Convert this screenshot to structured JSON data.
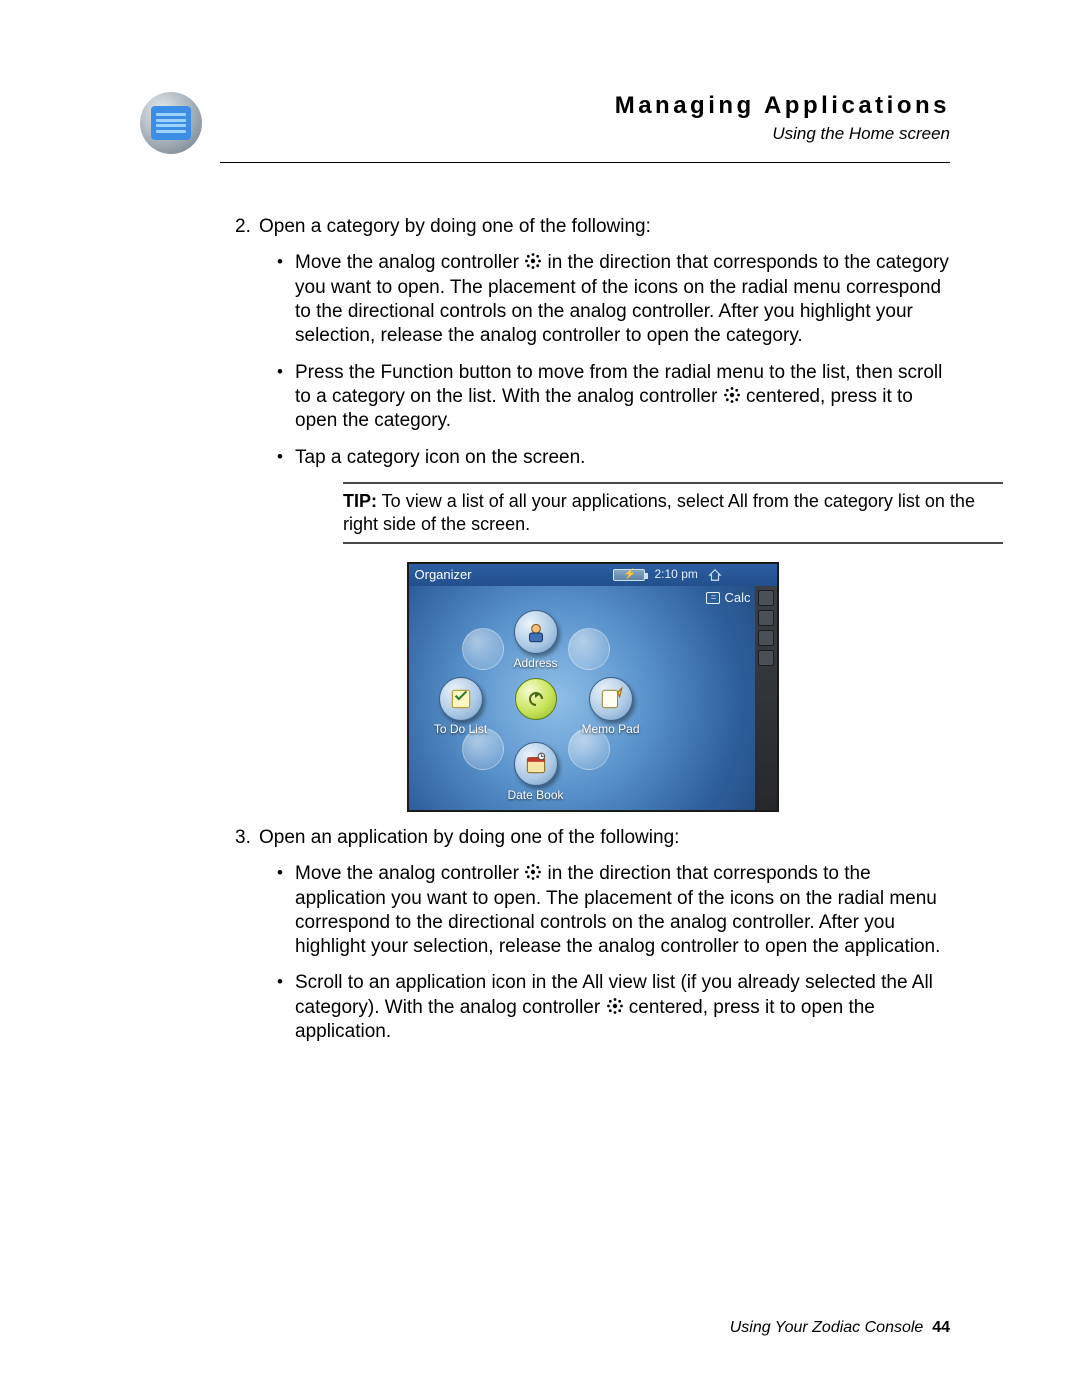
{
  "header": {
    "chapter_title": "Managing Applications",
    "section_title": "Using the Home screen"
  },
  "step2": {
    "num": "2.",
    "lead": "Open a category by doing one of the following:",
    "b1a": "Move the analog controller ",
    "b1b": " in the direction that corresponds to the category you want to open. The placement of the icons on the radial menu correspond to the directional controls on the analog controller. After you highlight your selection, release the analog controller to open the category.",
    "b2a": "Press the Function button to move from the radial menu to the list, then scroll to a category on the list. With the analog controller ",
    "b2b": " centered, press it to open the category.",
    "b3": "Tap a category icon on the screen."
  },
  "tip": {
    "label": "TIP:",
    "text": "   To view a list of all your applications, select All from the category list on the right side of the screen."
  },
  "device": {
    "titlebar_title": "Organizer",
    "time": "2:10 pm",
    "calc_label": "Calc",
    "app_address": "Address",
    "app_todo": "To Do List",
    "app_memo": "Memo Pad",
    "app_datebook": "Date Book"
  },
  "step3": {
    "num": "3.",
    "lead": "Open an application by doing one of the following:",
    "b1a": "Move the analog controller ",
    "b1b": " in the direction that corresponds to the application you want to open. The placement of the icons on the radial menu correspond to the directional controls on the analog controller. After you highlight your selection, release the analog controller to open the application.",
    "b2a": "Scroll to an application icon in the All view list (if you already selected the All category). With the analog controller ",
    "b2b": " centered, press it to open the application."
  },
  "footer": {
    "text": "Using Your Zodiac Console",
    "page": "44"
  }
}
